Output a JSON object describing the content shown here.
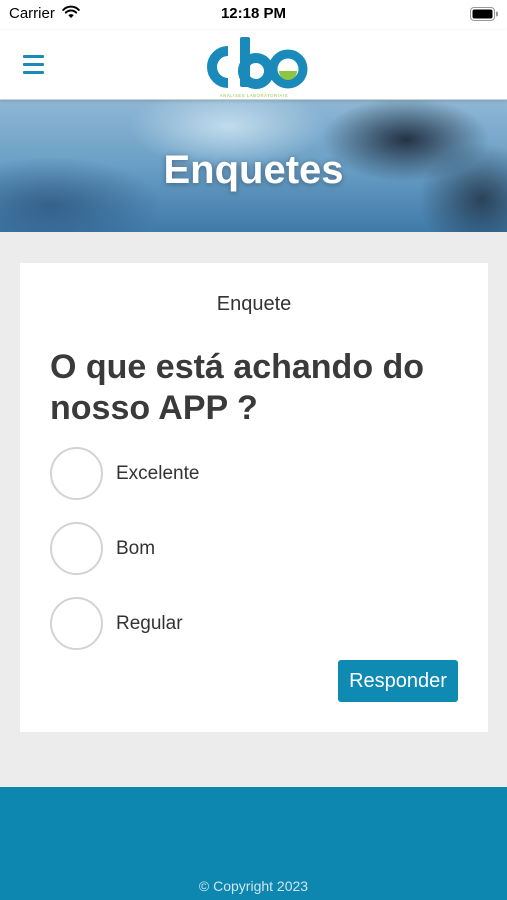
{
  "status_bar": {
    "carrier": "Carrier",
    "time": "12:18 PM"
  },
  "nav": {
    "logo_text": "cbo",
    "logo_tagline": "ANÁLISES LABORATORIAIS",
    "brand_color": "#1a8aba",
    "accent_color": "#8cc63f"
  },
  "hero": {
    "title": "Enquetes"
  },
  "poll": {
    "subtitle": "Enquete",
    "question": "O que está achando do nosso APP ?",
    "options": [
      {
        "label": "Excelente",
        "selected": false
      },
      {
        "label": "Bom",
        "selected": false
      },
      {
        "label": "Regular",
        "selected": false
      }
    ],
    "submit_label": "Responder"
  },
  "footer": {
    "copyright": "© Copyright 2023"
  }
}
